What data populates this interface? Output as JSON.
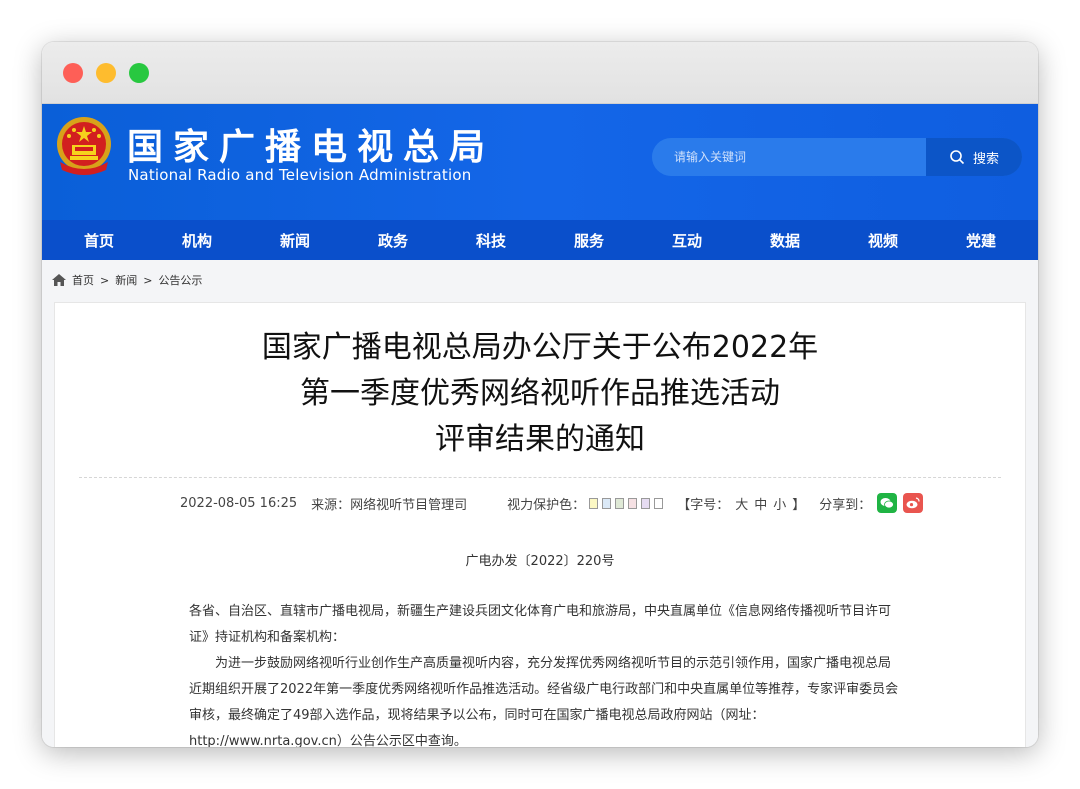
{
  "header": {
    "site_title": "国家广播电视总局",
    "site_subtitle": "National Radio and Television Administration",
    "search_placeholder": "请输入关键词",
    "search_button": "搜索"
  },
  "nav": {
    "items": [
      "首页",
      "机构",
      "新闻",
      "政务",
      "科技",
      "服务",
      "互动",
      "数据",
      "视频",
      "党建"
    ]
  },
  "breadcrumb": {
    "home": "首页",
    "news": "新闻",
    "current": "公告公示",
    "sep": ">"
  },
  "article": {
    "title_lines": [
      "国家广播电视总局办公厅关于公布2022年",
      "第一季度优秀网络视听作品推选活动",
      "评审结果的通知"
    ],
    "date": "2022-08-05 16:25",
    "source": "来源：网络视听节目管理司",
    "vision_label": "视力保护色：",
    "vision_colors": [
      "#fcf8c4",
      "#dbe9f7",
      "#dfe9d6",
      "#f6e1e4",
      "#e6dcf2",
      "#ffffff"
    ],
    "font_label": "【字号：",
    "font_sizes": [
      "大",
      "中",
      "小"
    ],
    "font_close": "】",
    "share_label": "分享到：",
    "doc_number": "广电办发〔2022〕220号",
    "paragraph_1": "各省、自治区、直辖市广播电视局，新疆生产建设兵团文化体育广电和旅游局，中央直属单位《信息网络传播视听节目许可证》持证机构和备案机构：",
    "paragraph_2": "为进一步鼓励网络视听行业创作生产高质量视听内容，充分发挥优秀网络视听节目的示范引领作用，国家广播电视总局近期组织开展了2022年第一季度优秀网络视听作品推选活动。经省级广电行政部门和中央直属单位等推荐，专家评审委员会审核，最终确定了49部入选作品，现将结果予以公布，同时可在国家广播电视总局政府网站（网址：http://www.nrta.gov.cn）公告公示区中查询。"
  }
}
